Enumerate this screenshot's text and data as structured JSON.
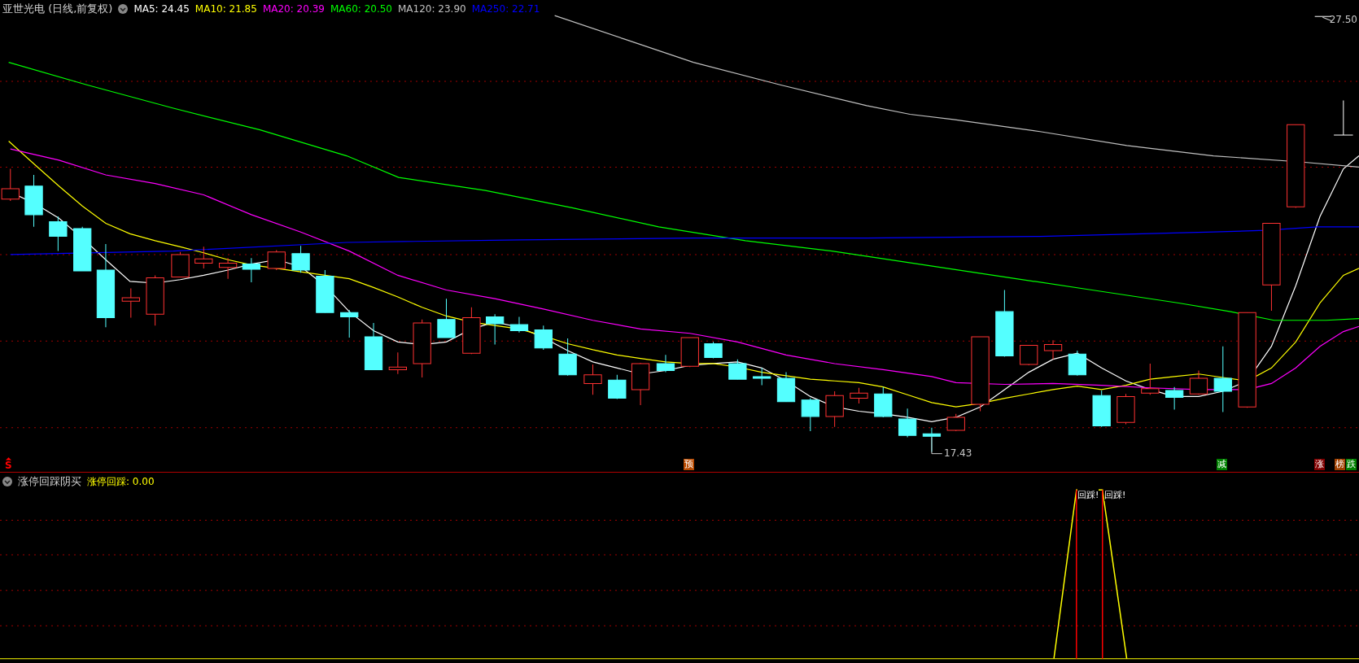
{
  "main_chart": {
    "title": "亚世光电 (日线,前复权)",
    "legend": [
      {
        "label": "MA5: 24.45",
        "color": "#ffffff"
      },
      {
        "label": "MA10: 21.85",
        "color": "#ffff00"
      },
      {
        "label": "MA20: 20.39",
        "color": "#ff00ff"
      },
      {
        "label": "MA60: 20.50",
        "color": "#00ff00"
      },
      {
        "label": "MA120: 23.90",
        "color": "#c0c0c0"
      },
      {
        "label": "MA250: 22.71",
        "color": "#0000ff"
      }
    ],
    "high_price": "27.50",
    "low_price": "17.43",
    "signals": [
      {
        "label": "S",
        "kind": "arrow",
        "color": "#ff0000"
      },
      {
        "label": "预",
        "kind": "tag",
        "color": "#b84a00"
      },
      {
        "label": "减",
        "kind": "tag",
        "color": "#008000"
      },
      {
        "label": "涨",
        "kind": "tag",
        "color": "#800000"
      },
      {
        "label": "榜",
        "kind": "tag",
        "color": "#a04000"
      },
      {
        "label": "跌",
        "kind": "tag",
        "color": "#008000"
      }
    ]
  },
  "indicator_panel": {
    "title": "涨停回踩阴买",
    "reading": "涨停回踩: 0.00",
    "labels": [
      "回踩!",
      "回踩!"
    ]
  }
}
